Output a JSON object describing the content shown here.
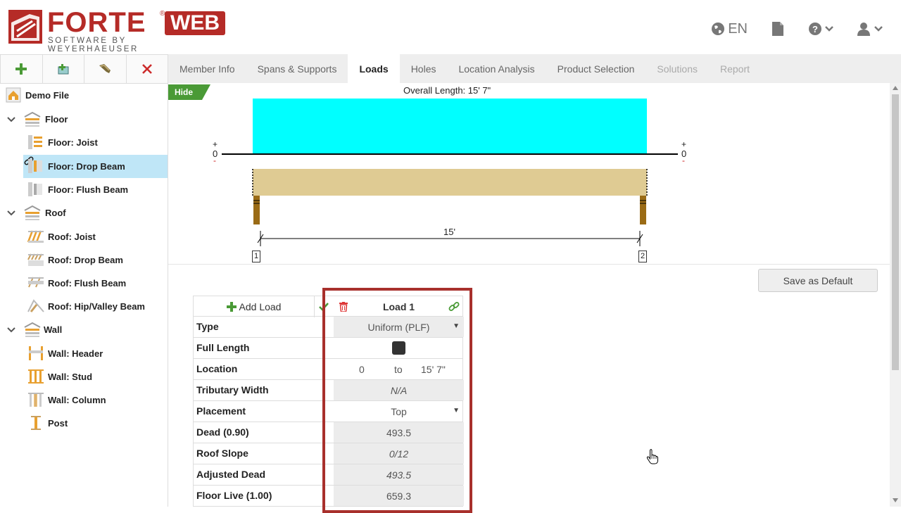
{
  "brand": {
    "name": "FORTE",
    "reg_mark": "®",
    "badge": "WEB",
    "subtitle": "SOFTWARE BY WEYERHAEUSER",
    "color": "#b52b27"
  },
  "header": {
    "language": "EN",
    "icons": [
      "globe-icon",
      "document-icon",
      "help-icon",
      "user-icon"
    ]
  },
  "toolbar": {
    "buttons": [
      "add-icon",
      "add-file-icon",
      "copy-member-icon",
      "delete-icon"
    ]
  },
  "tree": {
    "items": [
      {
        "label": "Demo File",
        "level": 0,
        "icon": "home-icon"
      },
      {
        "label": "Floor",
        "level": 1,
        "icon": "floor-group-icon",
        "expanded": true
      },
      {
        "label": "Floor: Joist",
        "level": 2,
        "icon": "floor-joist-icon"
      },
      {
        "label": "Floor: Drop Beam",
        "level": 2,
        "icon": "floor-drop-beam-icon",
        "selected": true
      },
      {
        "label": "Floor: Flush Beam",
        "level": 2,
        "icon": "floor-flush-beam-icon"
      },
      {
        "label": "Roof",
        "level": 1,
        "icon": "roof-group-icon",
        "expanded": true
      },
      {
        "label": "Roof: Joist",
        "level": 2,
        "icon": "roof-joist-icon"
      },
      {
        "label": "Roof: Drop Beam",
        "level": 2,
        "icon": "roof-drop-beam-icon"
      },
      {
        "label": "Roof: Flush Beam",
        "level": 2,
        "icon": "roof-flush-beam-icon"
      },
      {
        "label": "Roof: Hip/Valley Beam",
        "level": 2,
        "icon": "roof-hip-valley-icon"
      },
      {
        "label": "Wall",
        "level": 1,
        "icon": "wall-group-icon",
        "expanded": true
      },
      {
        "label": "Wall: Header",
        "level": 2,
        "icon": "wall-header-icon"
      },
      {
        "label": "Wall: Stud",
        "level": 2,
        "icon": "wall-stud-icon"
      },
      {
        "label": "Wall: Column",
        "level": 2,
        "icon": "wall-column-icon"
      },
      {
        "label": "Post",
        "level": 2,
        "icon": "post-icon"
      }
    ]
  },
  "tabs": [
    {
      "label": "Member Info",
      "state": "normal"
    },
    {
      "label": "Spans & Supports",
      "state": "normal"
    },
    {
      "label": "Loads",
      "state": "active"
    },
    {
      "label": "Holes",
      "state": "normal"
    },
    {
      "label": "Location Analysis",
      "state": "normal"
    },
    {
      "label": "Product Selection",
      "state": "normal"
    },
    {
      "label": "Solutions",
      "state": "disabled"
    },
    {
      "label": "Report",
      "state": "disabled"
    }
  ],
  "diagram": {
    "hide_label": "Hide",
    "overall_length": "Overall Length: 15' 7\"",
    "span_label": "15'",
    "load_color": "#00ffff",
    "beam_color": "#dfcb93",
    "support_color": "#9a6b15",
    "left_marks": {
      "plus": "+",
      "zero": "0",
      "minus": "-"
    },
    "right_marks": {
      "plus": "+",
      "zero": "0",
      "minus": "-"
    },
    "supports": [
      "1",
      "2"
    ]
  },
  "save_default_label": "Save as Default",
  "load_table": {
    "add_load_label": "Add Load",
    "load_title": "Load 1",
    "rows": {
      "type": {
        "label": "Type",
        "value": "Uniform (PLF)"
      },
      "full_length": {
        "label": "Full Length",
        "checked": true
      },
      "location": {
        "label": "Location",
        "from": "0",
        "to_word": "to",
        "to": "15' 7\""
      },
      "tributary_width": {
        "label": "Tributary Width",
        "value": "N/A"
      },
      "placement": {
        "label": "Placement",
        "value": "Top"
      },
      "dead": {
        "label": "Dead (0.90)",
        "value": "493.5"
      },
      "roof_slope": {
        "label": "Roof Slope",
        "value": "0/12"
      },
      "adjusted_dead": {
        "label": "Adjusted Dead",
        "value": "493.5"
      },
      "floor_live": {
        "label": "Floor Live (1.00)",
        "value": "659.3"
      }
    },
    "highlight_color": "#a8302c"
  }
}
